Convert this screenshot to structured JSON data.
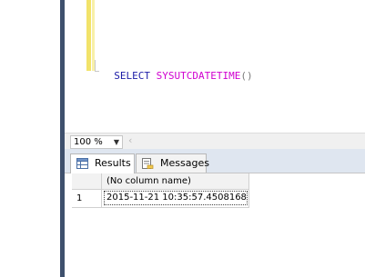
{
  "editor": {
    "tokens": [
      {
        "text": "SELECT",
        "kind": "keyword"
      },
      {
        "text": " ",
        "kind": "space"
      },
      {
        "text": "SYSUTCDATETIME",
        "kind": "function"
      },
      {
        "text": "()",
        "kind": "punctuation"
      }
    ]
  },
  "zoom": {
    "value": "100 %"
  },
  "tabs": [
    {
      "label": "Results",
      "icon": "grid-icon",
      "active": true
    },
    {
      "label": "Messages",
      "icon": "messages-icon",
      "active": false
    }
  ],
  "results": {
    "columns": [
      "(No column name)"
    ],
    "rows": [
      {
        "row_number": "1",
        "values": [
          "2015-11-21 10:35:57.4508168"
        ]
      }
    ]
  },
  "colors": {
    "keyword": "#1a1aa6",
    "function": "#d000d0",
    "punctuation": "#7a7a7a",
    "change_bar": "#f2e36a"
  }
}
